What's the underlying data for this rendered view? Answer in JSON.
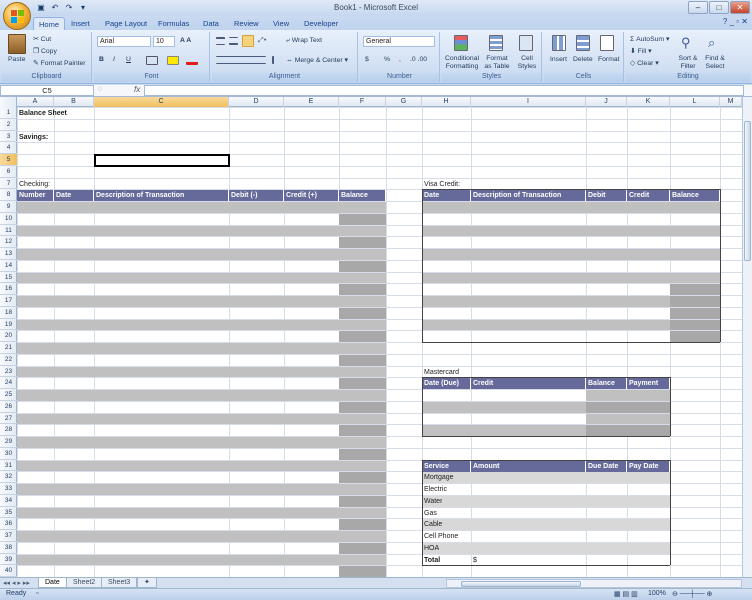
{
  "window": {
    "title": "Book1 - Microsoft Excel"
  },
  "ribbon_tabs": [
    "Home",
    "Insert",
    "Page Layout",
    "Formulas",
    "Data",
    "Review",
    "View",
    "Developer"
  ],
  "clipboard": {
    "paste": "Paste",
    "cut": "Cut",
    "copy": "Copy",
    "format_painter": "Format Painter",
    "label": "Clipboard"
  },
  "font": {
    "name": "Arial",
    "size": "10",
    "label": "Font",
    "bold": "B",
    "italic": "I",
    "underline": "U"
  },
  "alignment": {
    "wrap": "Wrap Text",
    "merge": "Merge & Center",
    "label": "Alignment"
  },
  "number": {
    "format": "General",
    "currency": "$",
    "percent": "%",
    "comma": ",",
    "label": "Number"
  },
  "styles": {
    "conditional": "Conditional Formatting",
    "table": "Format as Table",
    "cell": "Cell Styles",
    "label": "Styles"
  },
  "cells": {
    "insert": "Insert",
    "delete": "Delete",
    "format": "Format",
    "label": "Cells"
  },
  "editing": {
    "autosum": "AutoSum",
    "fill": "Fill",
    "clear": "Clear",
    "sort": "Sort & Filter",
    "find": "Find & Select",
    "label": "Editing"
  },
  "formula_bar": {
    "name_box": "C5",
    "fx": "fx",
    "formula": ""
  },
  "columns": [
    "A",
    "B",
    "C",
    "D",
    "E",
    "F",
    "G",
    "H",
    "I",
    "J",
    "K",
    "L",
    "M"
  ],
  "active_cell": "C5",
  "cells_text": {
    "title": "Balance Sheet",
    "savings": "Savings:",
    "checking": "Checking:",
    "visa": "Visa Credit:",
    "mastercard": "Mastercard",
    "total": "Total",
    "total_value": "$"
  },
  "checking_headers": [
    "Number",
    "Date",
    "Description of Transaction",
    "Debit (-)",
    "Credit (+)",
    "Balance"
  ],
  "visa_headers": [
    "Date",
    "Description of Transaction",
    "Debit",
    "Credit",
    "Balance"
  ],
  "mastercard_headers": [
    "Date (Due)",
    "Credit",
    "Balance",
    "Payment"
  ],
  "service_headers": [
    "Service",
    "Amount",
    "Due Date",
    "Pay Date"
  ],
  "services": [
    "Mortgage",
    "Electric",
    "Water",
    "Gas",
    "Cable",
    "Cell Phone",
    "HOA"
  ],
  "sheets": [
    "Date",
    "Sheet2",
    "Sheet3"
  ],
  "status": {
    "ready": "Ready",
    "zoom": "100%"
  },
  "colors": {
    "header_fill": "#666a9a",
    "shade": "#c0c0c0",
    "active_header": "#f1bf5c"
  }
}
